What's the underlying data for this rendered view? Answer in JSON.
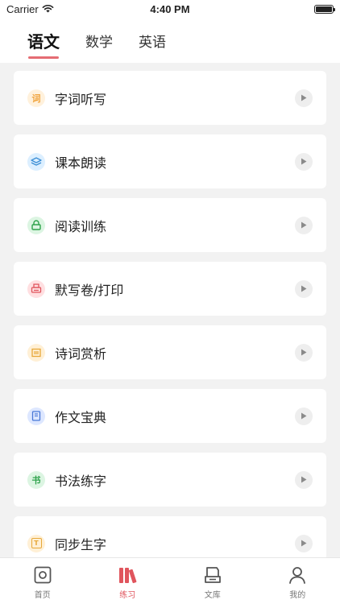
{
  "status_bar": {
    "carrier": "Carrier",
    "time": "4:40 PM",
    "battery_level": 1.0
  },
  "subject_tabs": [
    {
      "label": "语文",
      "active": true
    },
    {
      "label": "数学",
      "active": false
    },
    {
      "label": "英语",
      "active": false
    }
  ],
  "items": [
    {
      "label": "字词听写",
      "icon": "word-dictation-icon",
      "glyph": "词",
      "color": "#f0a23a",
      "bg": "#fff1dc"
    },
    {
      "label": "课本朗读",
      "icon": "textbook-reading-icon",
      "glyph": "",
      "color": "#3d8fd6",
      "bg": "#dcefff"
    },
    {
      "label": "阅读训练",
      "icon": "reading-training-icon",
      "glyph": "",
      "color": "#2ea24b",
      "bg": "#dcf5e2"
    },
    {
      "label": "默写卷/打印",
      "icon": "printer-icon",
      "glyph": "",
      "color": "#e0555d",
      "bg": "#ffdfe1"
    },
    {
      "label": "诗词赏析",
      "icon": "poetry-scroll-icon",
      "glyph": "",
      "color": "#e7a83a",
      "bg": "#fff0d6"
    },
    {
      "label": "作文宝典",
      "icon": "essay-book-icon",
      "glyph": "",
      "color": "#4a78d6",
      "bg": "#dde7ff"
    },
    {
      "label": "书法练字",
      "icon": "calligraphy-icon",
      "glyph": "书",
      "color": "#2ea24b",
      "bg": "#dcf5e2"
    },
    {
      "label": "同步生字",
      "icon": "sync-characters-icon",
      "glyph": "T",
      "color": "#e7a83a",
      "bg": "#fff0d6"
    }
  ],
  "bottom_tabs": [
    {
      "label": "首页",
      "icon": "home-icon",
      "active": false
    },
    {
      "label": "练习",
      "icon": "practice-icon",
      "active": true
    },
    {
      "label": "文库",
      "icon": "library-icon",
      "active": false
    },
    {
      "label": "我的",
      "icon": "profile-icon",
      "active": false
    }
  ],
  "colors": {
    "accent": "#e0555d",
    "tab_underline": "#e56c73",
    "background": "#f2f2f2"
  }
}
